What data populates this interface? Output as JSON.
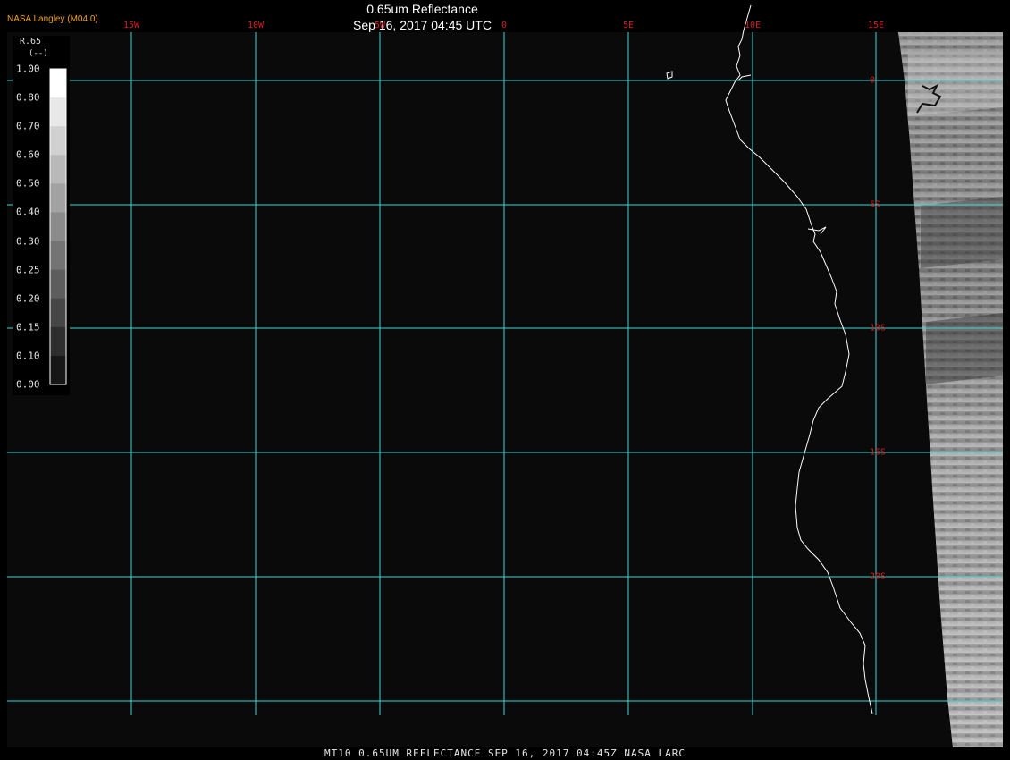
{
  "title": "0.65um Reflectance",
  "datetime": "Sep 16, 2017 04:45 UTC",
  "badge": "NASA Langley (M04.0)",
  "footer": "MT10  0.65UM REFLECTANCE   SEP 16, 2017 04:45Z   NASA LARC",
  "legend": {
    "name": "R.65",
    "unit": "(--)",
    "ticks": [
      "1.00",
      "0.80",
      "0.70",
      "0.60",
      "0.50",
      "0.40",
      "0.30",
      "0.25",
      "0.20",
      "0.15",
      "0.10",
      "0.00"
    ]
  },
  "grid": {
    "longitudes": [
      "15W",
      "10W",
      "5W",
      "0",
      "5E",
      "10E",
      "15E"
    ],
    "latitudes": [
      "0",
      "5S",
      "10S",
      "15S",
      "20S"
    ]
  },
  "colors": {
    "grid": "#3ad6d6",
    "labels": "#d02020",
    "coast": "#ffffff",
    "badge": "#f0a020"
  }
}
